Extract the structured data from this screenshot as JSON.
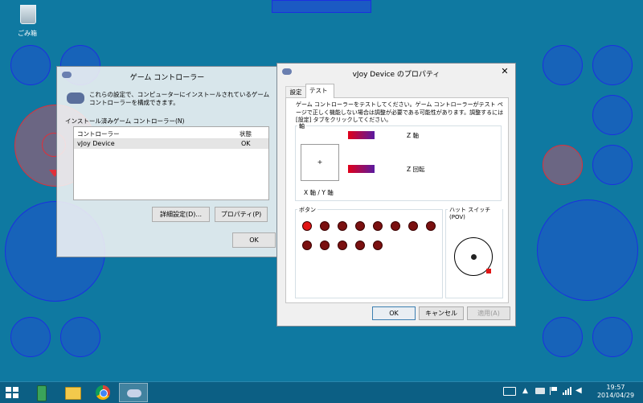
{
  "desktop": {
    "recycle_bin_label": "ごみ箱"
  },
  "game_controllers_window": {
    "title": "ゲーム コントローラー",
    "description": "これらの設定で、コンピューターにインストールされているゲーム コントローラーを構成できます。",
    "group_label": "インストール済みゲーム コントローラー(N)",
    "table_headers": [
      "コントローラー",
      "状態"
    ],
    "rows": [
      {
        "name": "vJoy Device",
        "status": "OK"
      }
    ],
    "advanced_button": "詳細設定(D)...",
    "properties_button": "プロパティ(P)",
    "ok_button": "OK"
  },
  "vjoy_window": {
    "title": "vJoy Device のプロパティ",
    "tabs": [
      "設定",
      "テスト"
    ],
    "active_tab": "テスト",
    "instructions": "ゲーム コントローラーをテストしてください。ゲーム コントローラーがテスト ページで正しく機能しない場合は調整が必要である可能性があります。調整するには [設定] タブをクリックしてください。",
    "axes_group_label": "軸",
    "z_axis_label": "Z 軸",
    "z_rotation_label": "Z 回転",
    "xy_axis_label": "X 軸 / Y 軸",
    "crosshair": "+",
    "buttons_group_label": "ボタン",
    "buttons_pressed": [
      true,
      false,
      false,
      false,
      false,
      false,
      false,
      false,
      false,
      false,
      false,
      false,
      false
    ],
    "hat_group_label": "ハット スイッチ (POV)",
    "ok_button": "OK",
    "cancel_button": "キャンセル",
    "apply_button": "適用(A)",
    "colors": {
      "axis_bar_start": "#e0001a",
      "axis_bar_end": "#5a1aa0",
      "pressed": "#e11515",
      "unpressed": "#7a1010"
    }
  },
  "taskbar": {
    "time": "19:57",
    "date": "2014/04/29",
    "colors": {
      "background": "#0c5f84"
    }
  }
}
